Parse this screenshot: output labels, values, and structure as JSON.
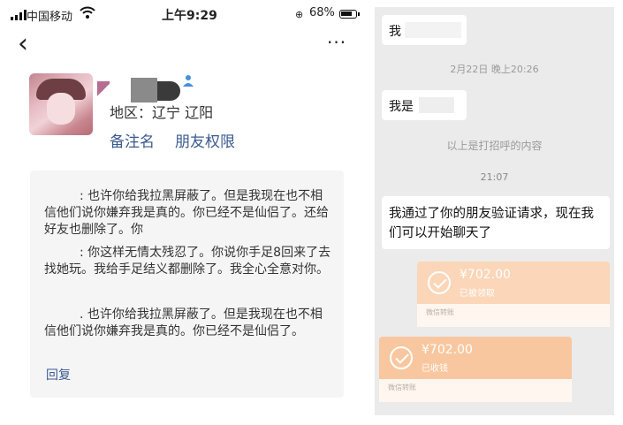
{
  "status_bar": {
    "carrier": "中国移动",
    "time": "上午9:29",
    "battery_percent": "68%"
  },
  "profile": {
    "region": "地区：辽宁 辽阳",
    "remark_link": "备注名",
    "permission_link": "朋友权限"
  },
  "comments": {
    "msg1_text": ": 也许你给我拉黑屏蔽了。但是我现在也不相信他们说你嫌弃我是真的。你已经不是仙侣了。还给好友也删除了。你",
    "msg2_text": ": 你这样无情太残忍了。你说你手足8回来了去找她玩。我给手足结义都删除了。我全心全意对你。",
    "msg3_text": ". 也许你给我拉黑屏蔽了。但是我现在也不相信他们说你嫌弃我是真的。你已经不是仙侣了。",
    "reply": "回复"
  },
  "chat": {
    "bubble1_text": "我",
    "ts1": "2月22日 晚上20:26",
    "bubble2_text": "我是",
    "system_note": "以上是打招呼的内容",
    "ts2": "21:07",
    "bubble3_text": "我通过了你的朋友验证请求，现在我们可以开始聊天了",
    "transfer1": {
      "amount": "¥702.00",
      "status": "已被领取",
      "label": "微信转账"
    },
    "transfer2": {
      "amount": "¥702.00",
      "status": "已收钱",
      "label": "微信转账"
    }
  },
  "colors": {
    "link_blue": "#3b5a8f",
    "transfer_received": "#f9c79f",
    "transfer_sent": "#fbd6b8",
    "chat_bg": "#ebebeb"
  },
  "icons": [
    "signal-icon",
    "wifi-icon",
    "alarm-icon",
    "battery-icon",
    "back-icon",
    "more-icon",
    "person-icon",
    "check-icon"
  ]
}
